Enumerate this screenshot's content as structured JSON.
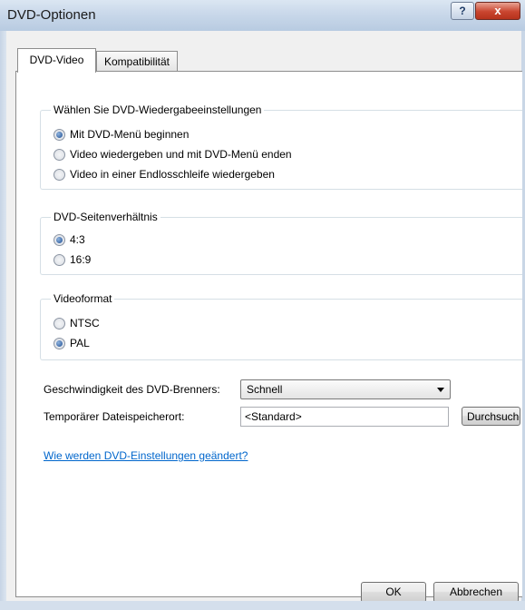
{
  "window": {
    "title": "DVD-Optionen",
    "help_label": "?",
    "close_label": "x"
  },
  "tabs": [
    {
      "label": "DVD-Video",
      "active": true
    },
    {
      "label": "Kompatibilität",
      "active": false
    }
  ],
  "playback_group": {
    "legend": "Wählen Sie DVD-Wiedergabeeinstellungen",
    "options": [
      {
        "label": "Mit DVD-Menü beginnen",
        "checked": true
      },
      {
        "label": "Video wiedergeben und mit DVD-Menü enden",
        "checked": false
      },
      {
        "label": "Video in einer Endlosschleife wiedergeben",
        "checked": false
      }
    ]
  },
  "aspect_group": {
    "legend": "DVD-Seitenverhältnis",
    "options": [
      {
        "label": "4:3",
        "checked": true
      },
      {
        "label": "16:9",
        "checked": false
      }
    ]
  },
  "format_group": {
    "legend": "Videoformat",
    "options": [
      {
        "label": "NTSC",
        "checked": false
      },
      {
        "label": "PAL",
        "checked": true
      }
    ]
  },
  "burner_speed": {
    "label": "Geschwindigkeit des DVD-Brenners:",
    "value": "Schnell"
  },
  "temp_location": {
    "label": "Temporärer Dateispeicherort:",
    "value": "<Standard>",
    "browse_label": "Durchsuchen..."
  },
  "help_link": "Wie werden DVD-Einstellungen geändert?",
  "buttons": {
    "ok": "OK",
    "cancel": "Abbrechen"
  }
}
